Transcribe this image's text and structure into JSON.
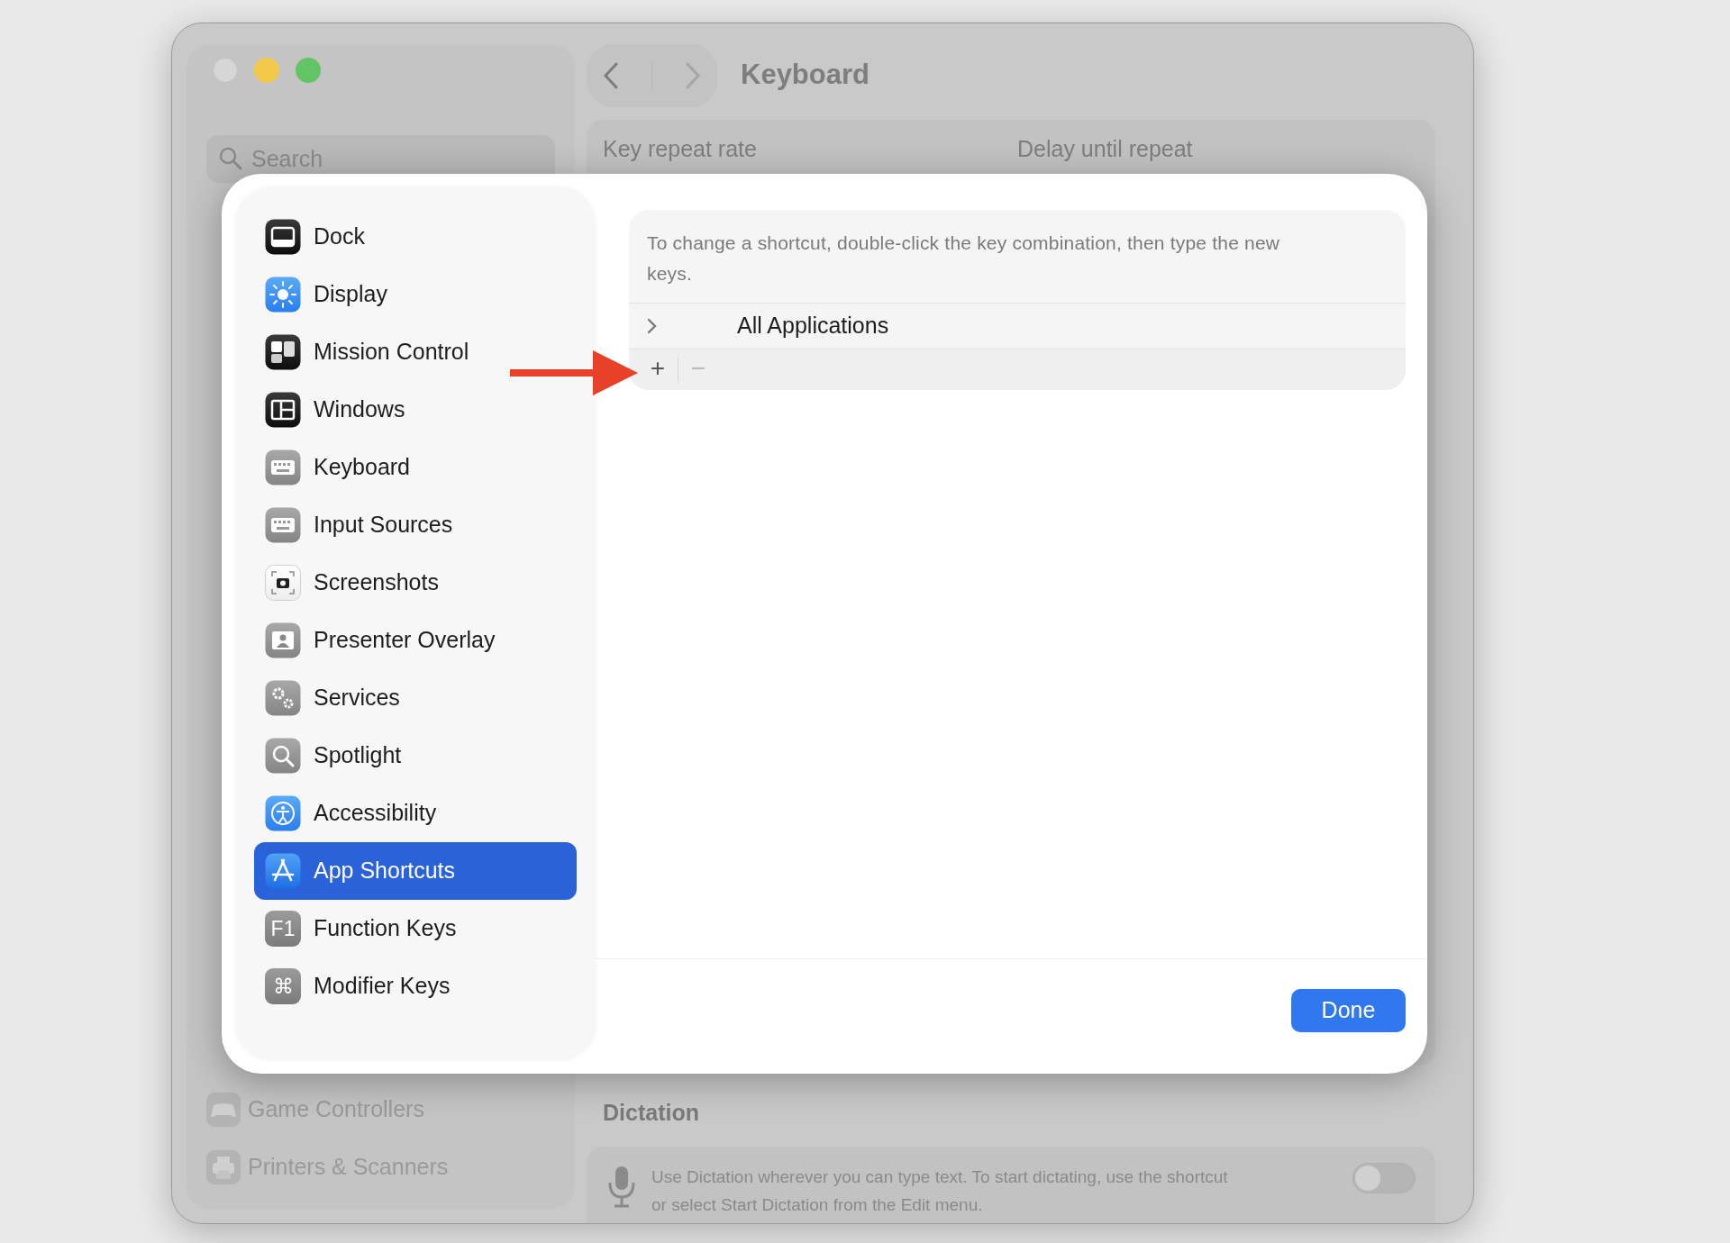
{
  "window": {
    "title": "Keyboard"
  },
  "sidebar": {
    "search": {
      "placeholder": "Search"
    },
    "items": [
      {
        "label": "Game Controllers",
        "kind": "gamepad"
      },
      {
        "label": "Printers & Scanners",
        "kind": "printer"
      }
    ]
  },
  "main": {
    "key_repeat": {
      "labels": [
        "Key repeat rate",
        "Delay until repeat"
      ]
    },
    "dictation": {
      "heading": "Dictation",
      "description": "Use Dictation wherever you can type text. To start dictating, use the shortcut or select Start Dictation from the Edit menu.",
      "on": false
    }
  },
  "sheet": {
    "nav": [
      {
        "label": "Dock",
        "kind": "dock",
        "selected": false
      },
      {
        "label": "Display",
        "kind": "display",
        "selected": false
      },
      {
        "label": "Mission Control",
        "kind": "mission",
        "selected": false
      },
      {
        "label": "Windows",
        "kind": "windows",
        "selected": false
      },
      {
        "label": "Keyboard",
        "kind": "keyboard",
        "selected": false
      },
      {
        "label": "Input Sources",
        "kind": "keyboard",
        "selected": false
      },
      {
        "label": "Screenshots",
        "kind": "screenshot",
        "selected": false
      },
      {
        "label": "Presenter Overlay",
        "kind": "presenter",
        "selected": false
      },
      {
        "label": "Services",
        "kind": "services",
        "selected": false
      },
      {
        "label": "Spotlight",
        "kind": "spotlight",
        "selected": false
      },
      {
        "label": "Accessibility",
        "kind": "accessibility",
        "selected": false
      },
      {
        "label": "App Shortcuts",
        "kind": "appstore",
        "selected": true
      },
      {
        "label": "Function Keys",
        "kind": "glyph",
        "glyph": "F1",
        "selected": false
      },
      {
        "label": "Modifier Keys",
        "kind": "glyph",
        "glyph": "⌘",
        "selected": false
      }
    ],
    "hint": "To change a shortcut, double-click the key combination, then type the new keys.",
    "groups": [
      {
        "label": "All Applications",
        "expanded": false
      }
    ],
    "toolbar": [
      {
        "symbol": "+",
        "disabled": false
      },
      {
        "symbol": "−",
        "disabled": true
      }
    ],
    "done_button": "Done"
  }
}
